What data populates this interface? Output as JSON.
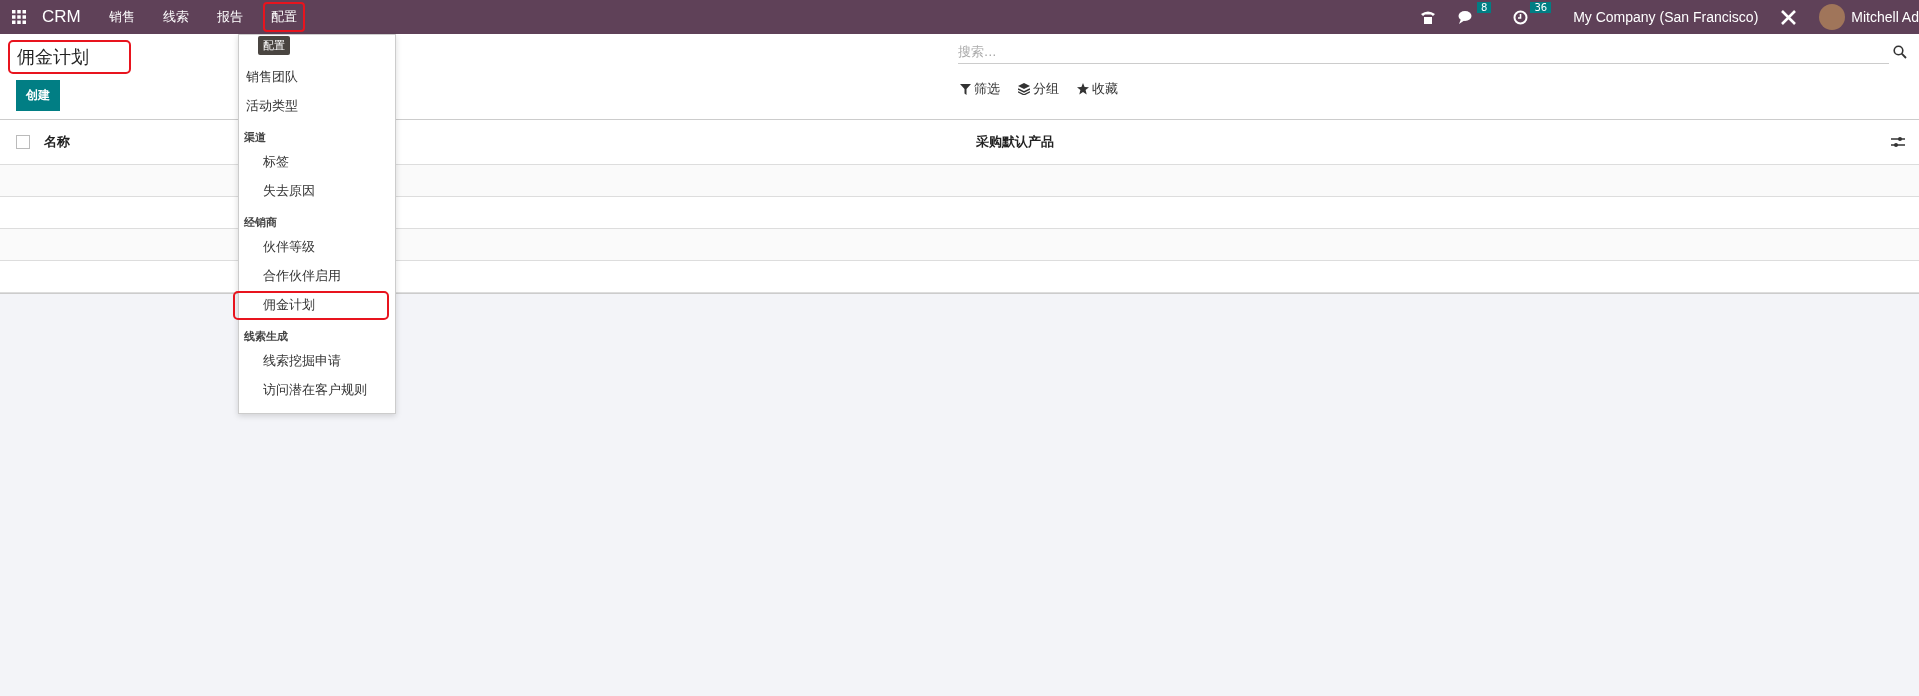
{
  "navbar": {
    "app_name": "CRM",
    "menus": [
      {
        "label": "销售",
        "highlighted": false
      },
      {
        "label": "线索",
        "highlighted": false
      },
      {
        "label": "报告",
        "highlighted": false
      },
      {
        "label": "配置",
        "highlighted": true
      }
    ],
    "messages_badge": "8",
    "activities_badge": "36",
    "company": "My Company (San Francisco)",
    "user": "Mitchell Ad"
  },
  "tooltip": "配置",
  "dropdown": {
    "sections": [
      {
        "items": [
          {
            "label": "销售团队",
            "highlighted": false
          },
          {
            "label": "活动类型",
            "highlighted": false
          }
        ]
      },
      {
        "header": "渠道",
        "items": [
          {
            "label": "标签",
            "highlighted": false
          },
          {
            "label": "失去原因",
            "highlighted": false
          }
        ]
      },
      {
        "header": "经销商",
        "items": [
          {
            "label": "伙伴等级",
            "highlighted": false
          },
          {
            "label": "合作伙伴启用",
            "highlighted": false
          },
          {
            "label": "佣金计划",
            "highlighted": true
          }
        ]
      },
      {
        "header": "线索生成",
        "items": [
          {
            "label": "线索挖掘申请",
            "highlighted": false
          },
          {
            "label": "访问潜在客户规则",
            "highlighted": false
          }
        ]
      }
    ]
  },
  "page": {
    "title": "佣金计划",
    "title_highlighted": true,
    "create_button": "创建"
  },
  "search": {
    "placeholder": "搜索..."
  },
  "filters": [
    {
      "kind": "filter",
      "label": "筛选"
    },
    {
      "kind": "group",
      "label": "分组"
    },
    {
      "kind": "favorite",
      "label": "收藏"
    }
  ],
  "table": {
    "select_all_checked": false,
    "columns": [
      "名称",
      "采购默认产品"
    ]
  }
}
